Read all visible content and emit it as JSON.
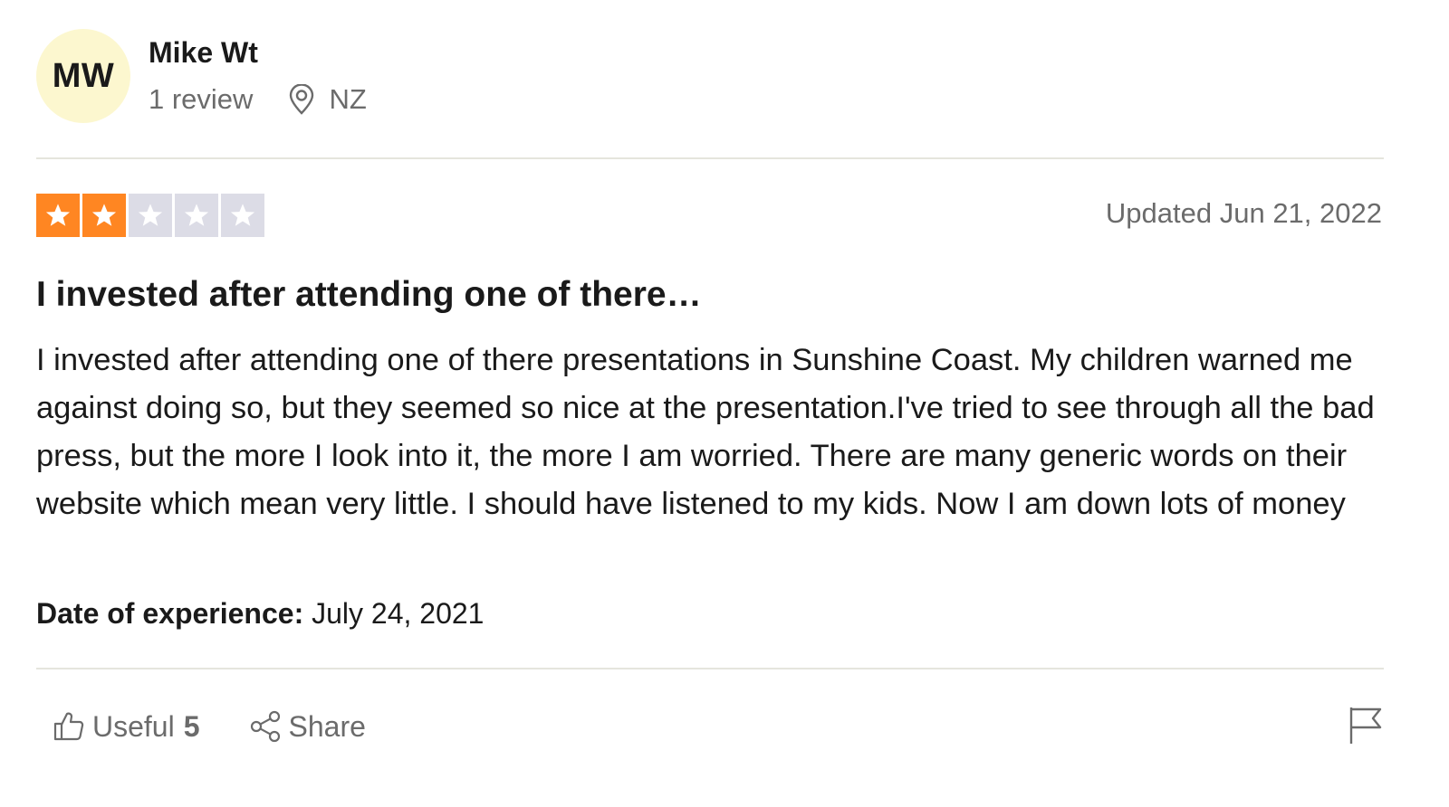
{
  "consumer": {
    "initials": "MW",
    "name": "Mike Wt",
    "review_count": "1 review",
    "country": "NZ",
    "avatar_color": "#fcf7cf",
    "location_icon": "location-pin-icon"
  },
  "rating": {
    "stars": 2,
    "max_stars": 5,
    "filled_color": "#ff8622",
    "empty_color": "#dcdce6",
    "updated_date": "Updated Jun 21, 2022"
  },
  "review": {
    "title": "I invested after attending one of there…",
    "body": "I invested after attending one of there presentations in Sunshine Coast. My children warned me against doing so, but they seemed so nice at the presentation.I've tried to see through all the bad press, but the more I look into it, the more I am worried. There are many generic words on their website which mean very little. I should have listened to my kids. Now I am down lots of money",
    "experience_label": "Date of experience:",
    "experience_date": "July 24, 2021"
  },
  "actions": {
    "useful_label": "Useful",
    "useful_count": "5",
    "useful_icon": "thumbs-up-icon",
    "share_label": "Share",
    "share_icon": "share-icon",
    "report_icon": "flag-icon"
  }
}
